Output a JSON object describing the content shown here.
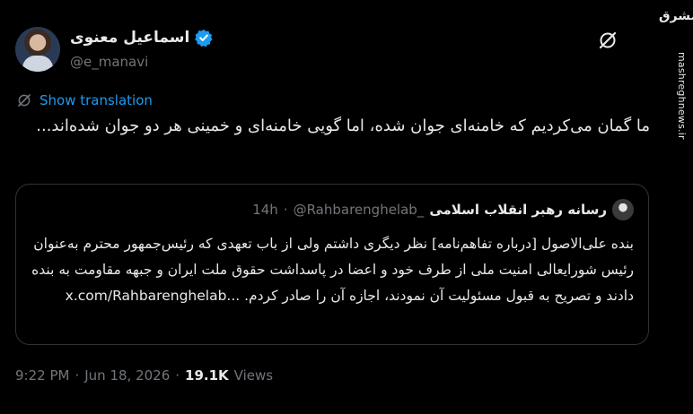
{
  "author": {
    "display_name": "اسماعیل معنوی",
    "handle": "@e_manavi",
    "verified": true
  },
  "translation": {
    "label": "Show translation"
  },
  "tweet": {
    "text": "ما گمان می‌کردیم که خامنه‌ای جوان شده، اما گویی خامنه‌ای و خمینی هر دو جوان شده‌اند..."
  },
  "quote": {
    "display_name": "رسانه رهبر انقلاب اسلامی",
    "handle": "@Rahbarenghelab_",
    "separator": "·",
    "time": "14h",
    "text": "بنده علی‌الاصول [درباره تفاهم‌نامه] نظر دیگری داشتم ولی از باب تعهدی که رئیس‌جمهور محترم به‌عنوان رئیس شورایعالی امنیت ملی از طرف خود و اعضا در پاسداشت حقوق ملت ایران و جبهه مقاومت به بنده دادند و تصریح به قبول مسئولیت آن نمودند، اجازه آن را صادر کردم.",
    "link": "x.com/Rahbarenghelab..."
  },
  "meta": {
    "time": "9:22 PM",
    "separator": "·",
    "date": "Jun 18, 2026",
    "separator2": "·",
    "views_count": "19.1K",
    "views_label": "Views"
  },
  "watermark": {
    "logo_text": "مشرق",
    "site": "mashreghnews.ir"
  },
  "colors": {
    "background": "#000000",
    "text": "#e7e9ea",
    "muted": "#71767b",
    "accent": "#1d9bf0",
    "border": "#2f3336"
  },
  "icons": [
    "verified-badge-icon",
    "grok-icon",
    "translate-icon"
  ]
}
